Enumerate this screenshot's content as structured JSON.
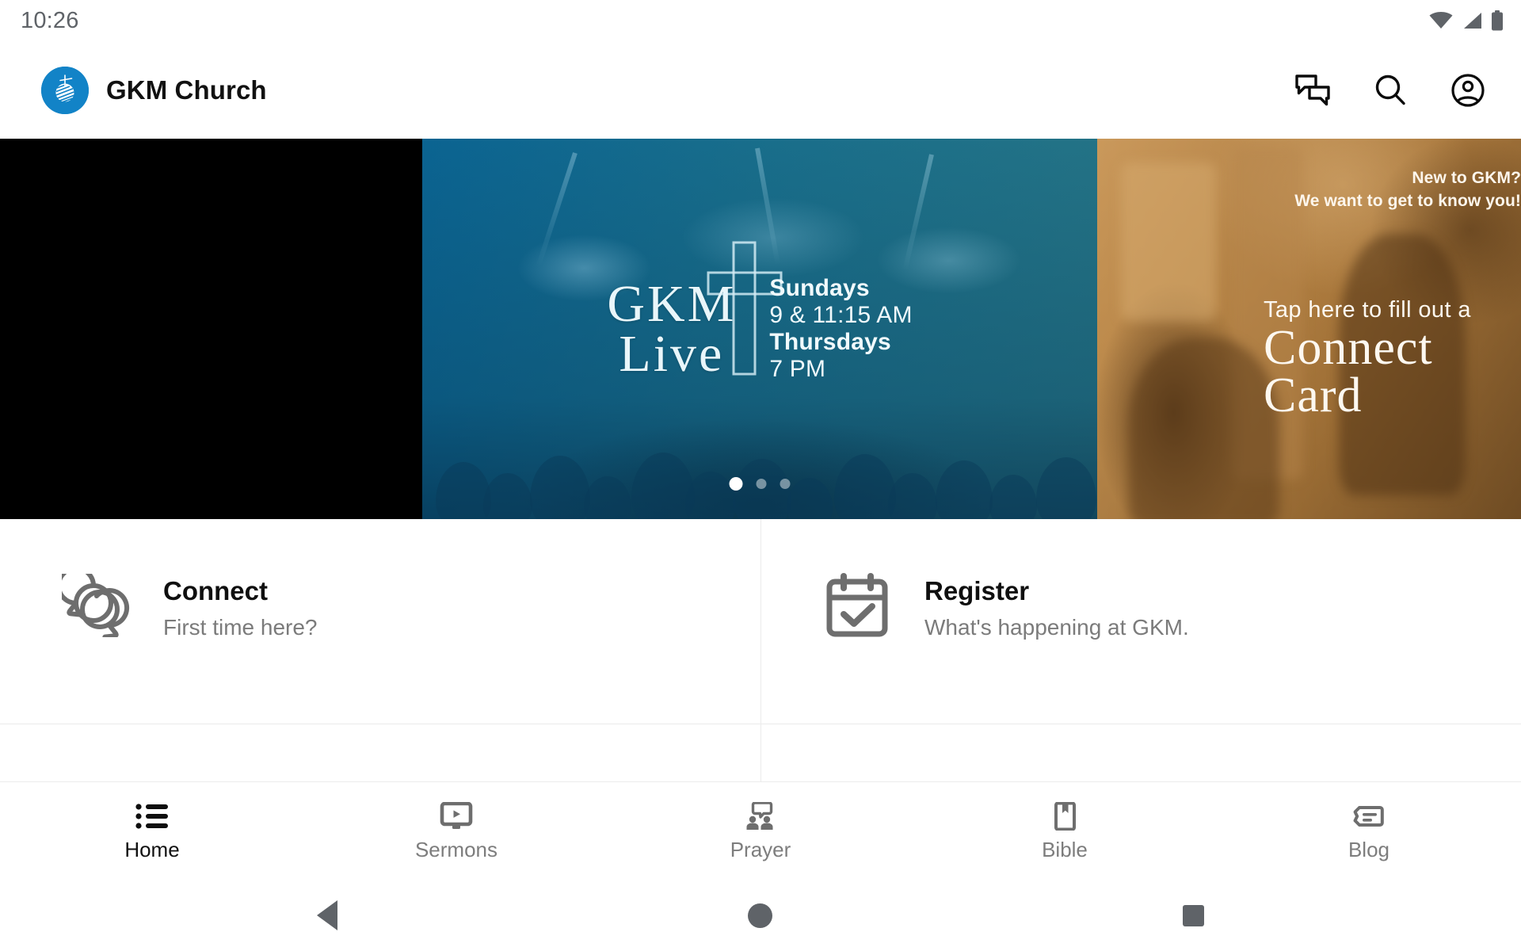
{
  "status_bar": {
    "clock": "10:26",
    "icons": [
      "wifi-icon",
      "cell-signal-icon",
      "battery-icon"
    ]
  },
  "app_bar": {
    "logo_icon": "gkm-globe-logo",
    "title": "GKM Church",
    "actions": [
      {
        "name": "chat-icon",
        "label": "Chat"
      },
      {
        "name": "search-icon",
        "label": "Search"
      },
      {
        "name": "account-icon",
        "label": "Account"
      }
    ]
  },
  "carousel": {
    "active_index": 0,
    "dots": 3,
    "slides": [
      {
        "id": "slide-black",
        "kind": "blank"
      },
      {
        "id": "slide-gkm-live",
        "kind": "gkm-live",
        "brand_line1": "GKM",
        "brand_line2": "Live",
        "times": [
          {
            "text": "Sundays",
            "bold": true
          },
          {
            "text": "9 & 11:15 AM",
            "bold": false
          },
          {
            "text": "Thursdays",
            "bold": true
          },
          {
            "text": "7 PM",
            "bold": false
          }
        ]
      },
      {
        "id": "slide-connect-card",
        "kind": "connect-card",
        "eyebrow_line1": "New to GKM?",
        "eyebrow_line2": "We want to get to know you!",
        "tap_line": "Tap here to fill out a",
        "big_line1": "Connect",
        "big_line2": "Card"
      }
    ]
  },
  "quick_cards": [
    {
      "icon": "chat-bubbles-icon",
      "title": "Connect",
      "subtitle": "First time here?"
    },
    {
      "icon": "calendar-check-icon",
      "title": "Register",
      "subtitle": "What's happening at GKM."
    }
  ],
  "bottom_nav": {
    "active": "Home",
    "items": [
      {
        "icon": "list-icon",
        "label": "Home"
      },
      {
        "icon": "tv-play-icon",
        "label": "Sermons"
      },
      {
        "icon": "people-speech-icon",
        "label": "Prayer"
      },
      {
        "icon": "book-bookmark-icon",
        "label": "Bible"
      },
      {
        "icon": "message-lines-icon",
        "label": "Blog"
      }
    ]
  },
  "system_nav": {
    "back": "back-button",
    "home": "home-button",
    "recents": "recents-button"
  },
  "colors": {
    "brand_blue": "#1283c7",
    "slide_teal": "#1e7f9f",
    "slide_amber": "#b8813f",
    "text_primary": "#111111",
    "text_secondary": "#7b7b7b",
    "icon_gray": "#6e6e6e"
  }
}
